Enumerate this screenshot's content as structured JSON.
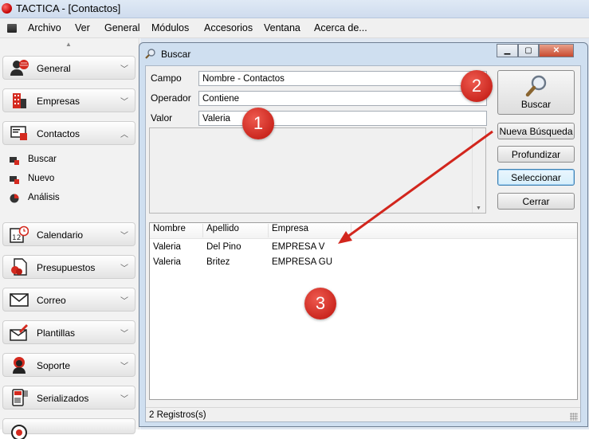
{
  "app": {
    "title": "TACTICA - [Contactos]"
  },
  "menu": {
    "items": [
      "Archivo",
      "Ver",
      "General",
      "Módulos",
      "Accesorios",
      "Ventana",
      "Acerca de..."
    ]
  },
  "sidebar": {
    "items": [
      {
        "label": "General",
        "expanded": false
      },
      {
        "label": "Empresas",
        "expanded": false
      },
      {
        "label": "Contactos",
        "expanded": true
      },
      {
        "label": "Calendario",
        "expanded": false
      },
      {
        "label": "Presupuestos",
        "expanded": false
      },
      {
        "label": "Correo",
        "expanded": false
      },
      {
        "label": "Plantillas",
        "expanded": false
      },
      {
        "label": "Soporte",
        "expanded": false
      },
      {
        "label": "Serializados",
        "expanded": false
      }
    ],
    "sub_items": [
      "Buscar",
      "Nuevo",
      "Análisis"
    ]
  },
  "dialog": {
    "title": "Buscar",
    "fields": {
      "campo": {
        "label": "Campo",
        "value": "Nombre - Contactos"
      },
      "operador": {
        "label": "Operador",
        "value": "Contiene"
      },
      "valor": {
        "label": "Valor",
        "value": "Valeria"
      }
    },
    "buttons": {
      "buscar": "Buscar",
      "nueva_busqueda": "Nueva Búsqueda",
      "profundizar": "Profundizar",
      "seleccionar": "Seleccionar",
      "cerrar": "Cerrar"
    },
    "results": {
      "columns": [
        "Nombre",
        "Apellido",
        "Empresa"
      ],
      "rows": [
        [
          "Valeria",
          "Del Pino",
          "EMPRESA V"
        ],
        [
          "Valeria",
          "Britez",
          "EMPRESA GU"
        ]
      ]
    },
    "status": "2 Registros(s)"
  },
  "annotations": {
    "badges": [
      "1",
      "2",
      "3"
    ],
    "color": "#d2261d"
  },
  "colors": {
    "dialog_frame": "#cfdff0",
    "accent_red": "#c9241c",
    "default_button": "#3c7fb1"
  }
}
